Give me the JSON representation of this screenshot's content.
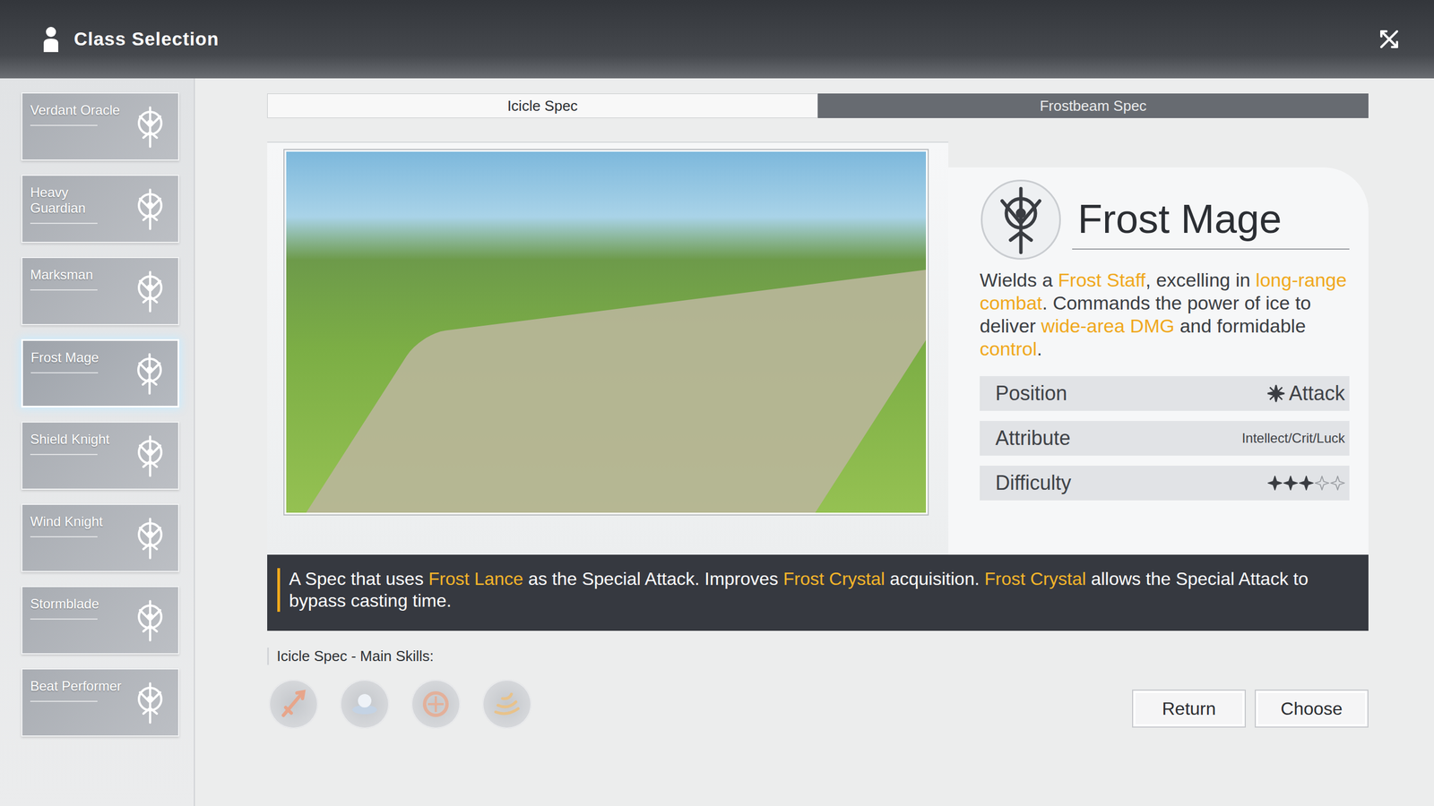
{
  "header": {
    "title": "Class Selection"
  },
  "classes": [
    {
      "name": "Verdant Oracle",
      "selected": false
    },
    {
      "name": "Heavy Guardian",
      "selected": false
    },
    {
      "name": "Marksman",
      "selected": false
    },
    {
      "name": "Frost Mage",
      "selected": true
    },
    {
      "name": "Shield Knight",
      "selected": false
    },
    {
      "name": "Wind Knight",
      "selected": false
    },
    {
      "name": "Stormblade",
      "selected": false
    },
    {
      "name": "Beat Performer",
      "selected": false
    }
  ],
  "tabs": [
    {
      "label": "Icicle Spec",
      "selected": true
    },
    {
      "label": "Frostbeam Spec",
      "selected": false
    }
  ],
  "class_info": {
    "name": "Frost Mage",
    "description": [
      {
        "text": "Wields a ",
        "highlight": false
      },
      {
        "text": "Frost Staff",
        "highlight": true
      },
      {
        "text": ", excelling in ",
        "highlight": false
      },
      {
        "text": "long-range combat",
        "highlight": true
      },
      {
        "text": ". Commands the power of ice to deliver ",
        "highlight": false
      },
      {
        "text": "wide-area DMG",
        "highlight": true
      },
      {
        "text": " and formidable ",
        "highlight": false
      },
      {
        "text": "control",
        "highlight": true
      },
      {
        "text": ".",
        "highlight": false
      }
    ],
    "stats": [
      {
        "label": "Position",
        "kind": "role",
        "value": "Attack"
      },
      {
        "label": "Attribute",
        "kind": "text",
        "value": "Intellect/Crit/Luck"
      },
      {
        "label": "Difficulty",
        "kind": "stars",
        "stars": 3,
        "stars_total": 5
      }
    ]
  },
  "spec_description": [
    {
      "text": "A Spec that uses ",
      "highlight": false
    },
    {
      "text": "Frost Lance",
      "highlight": true
    },
    {
      "text": " as the Special Attack. Improves ",
      "highlight": false
    },
    {
      "text": "Frost Crystal",
      "highlight": true
    },
    {
      "text": " acquisition. ",
      "highlight": false
    },
    {
      "text": "Frost Crystal",
      "highlight": true
    },
    {
      "text": " allows the Special Attack to bypass casting time.",
      "highlight": false
    }
  ],
  "skills_title": "Icicle Spec - Main Skills:",
  "buttons": [
    {
      "label": "Return"
    },
    {
      "label": "Choose"
    }
  ]
}
